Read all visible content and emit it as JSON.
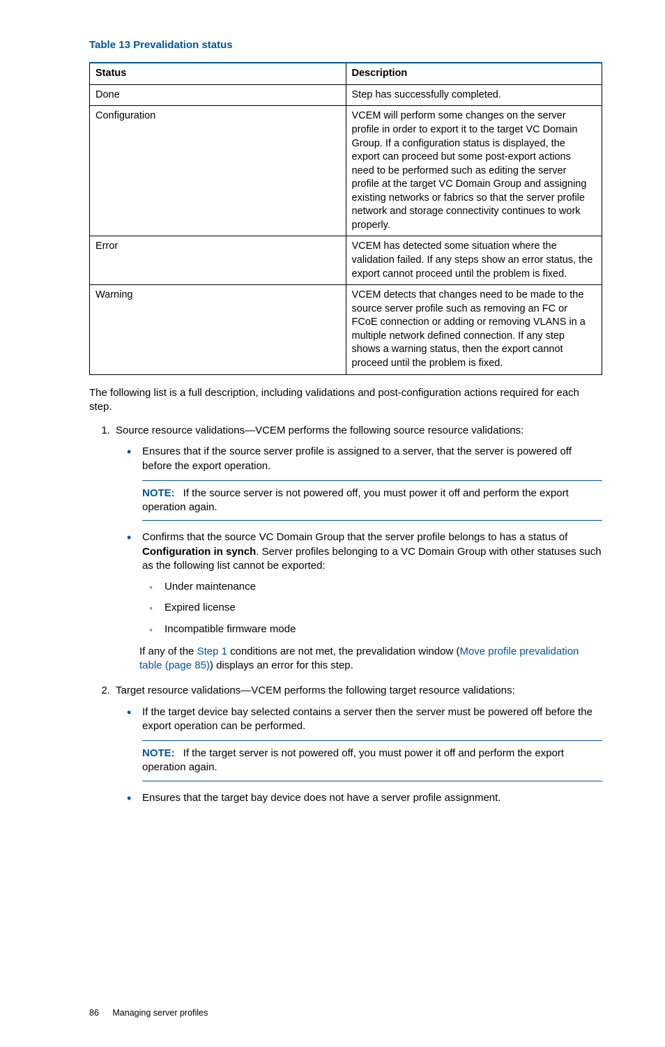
{
  "table": {
    "title": "Table 13 Prevalidation status",
    "headers": {
      "c0": "Status",
      "c1": "Description"
    },
    "rows": [
      {
        "status": "Done",
        "desc": "Step has successfully completed."
      },
      {
        "status": "Configuration",
        "desc": "VCEM will perform some changes on the server profile in order to export it to the target VC Domain Group. If a configuration status is displayed, the export can proceed but some post-export actions need to be performed such as editing the server profile at the target VC Domain Group and assigning existing networks or fabrics so that the server profile network and storage connectivity continues to work properly."
      },
      {
        "status": "Error",
        "desc": "VCEM has detected some situation where the validation failed. If any steps show an error status, the export cannot proceed until the problem is fixed."
      },
      {
        "status": "Warning",
        "desc": "VCEM detects that changes need to be made to the source server profile such as removing an FC or FCoE connection or adding or removing VLANS in a multiple network defined connection. If any step shows a warning status, then the export cannot proceed until the problem is fixed."
      }
    ]
  },
  "intro_para": "The following list is a full description, including validations and post-configuration actions required for each step.",
  "step1": {
    "lead": "Source resource validations—VCEM performs the following source resource validations:",
    "b1": "Ensures that if the source server profile is assigned to a server, that the server is powered off before the export operation.",
    "note1_label": "NOTE:",
    "note1_text": "If the source server is not powered off, you must power it off and perform the export operation again.",
    "b2_pre": "Confirms that the source VC Domain Group that the server profile belongs to has a status of ",
    "b2_bold": "Configuration in synch",
    "b2_post": ". Server profiles belonging to a VC Domain Group with other statuses such as the following list cannot be exported:",
    "sub1": "Under maintenance",
    "sub2": "Expired license",
    "sub3": "Incompatible firmware mode",
    "ifany_pre": "If any of the ",
    "ifany_link1": "Step 1",
    "ifany_mid": " conditions are not met, the prevalidation window (",
    "ifany_link2": "Move profile prevalidation table (page 85)",
    "ifany_post": ") displays an error for this step."
  },
  "step2": {
    "lead": "Target resource validations—VCEM performs the following target resource validations:",
    "b1": "If the target device bay selected contains a server then the server must be powered off before the export operation can be performed.",
    "note_label": "NOTE:",
    "note_text": "If the target server is not powered off, you must power it off and perform the export operation again.",
    "b2": "Ensures that the target bay device does not have a server profile assignment."
  },
  "footer": {
    "page": "86",
    "section": "Managing server profiles"
  }
}
